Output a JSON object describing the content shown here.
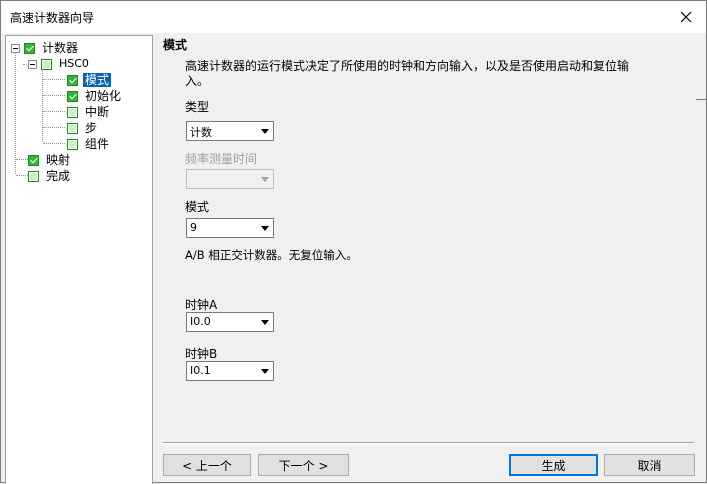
{
  "window": {
    "title": "高速计数器向导"
  },
  "tree": {
    "items": [
      {
        "label": "计数器",
        "checked": true
      },
      {
        "label": "HSC0",
        "checked": false
      },
      {
        "label": "模式",
        "checked": true,
        "selected": true
      },
      {
        "label": "初始化",
        "checked": true
      },
      {
        "label": "中断",
        "checked": false
      },
      {
        "label": "步",
        "checked": false
      },
      {
        "label": "组件",
        "checked": false
      },
      {
        "label": "映射",
        "checked": true
      },
      {
        "label": "完成",
        "checked": false
      }
    ]
  },
  "panel": {
    "heading": "模式",
    "description_line1": "高速计数器的运行模式决定了所使用的时钟和方向输入，以及是否使用启动和复位输",
    "description_line2": "入。",
    "type": {
      "label": "类型",
      "value": "计数"
    },
    "freq_time": {
      "label": "频率测量时间",
      "value": ""
    },
    "mode": {
      "label": "模式",
      "value": "9",
      "info": "A/B 相正交计数器。无复位输入。"
    },
    "clock_a": {
      "label": "时钟A",
      "value": "I0.0"
    },
    "clock_b": {
      "label": "时钟B",
      "value": "I0.1"
    }
  },
  "buttons": {
    "prev": "< 上一个",
    "next": "下一个 >",
    "generate": "生成",
    "cancel": "取消"
  }
}
